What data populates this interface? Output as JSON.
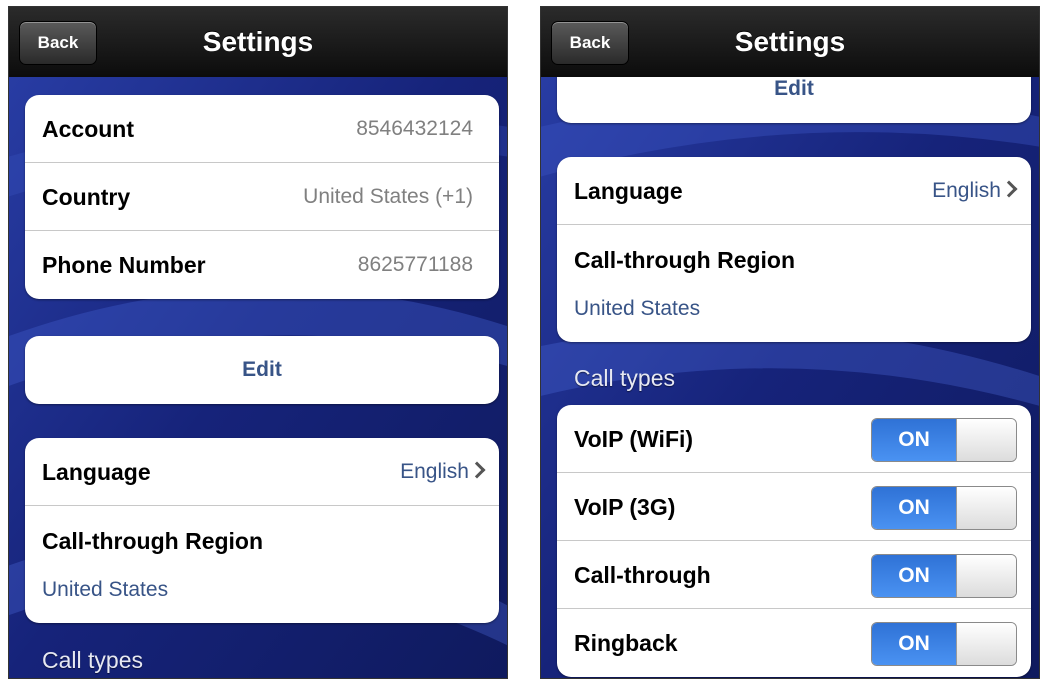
{
  "left_screen": {
    "nav": {
      "back_label": "Back",
      "title": "Settings"
    },
    "account_group": [
      {
        "label": "Account",
        "value": "8546432124"
      },
      {
        "label": "Country",
        "value": "United States (+1)"
      },
      {
        "label": "Phone Number",
        "value": "8625771188"
      }
    ],
    "edit_label": "Edit",
    "language": {
      "label": "Language",
      "value": "English"
    },
    "call_through": {
      "label": "Call-through Region",
      "value": "United States"
    },
    "call_types_header": "Call types"
  },
  "right_screen": {
    "nav": {
      "back_label": "Back",
      "title": "Settings"
    },
    "edit_label": "Edit",
    "language": {
      "label": "Language",
      "value": "English"
    },
    "call_through": {
      "label": "Call-through Region",
      "value": "United States"
    },
    "call_types_header": "Call types",
    "call_types": [
      {
        "label": "VoIP (WiFi)",
        "state": "ON"
      },
      {
        "label": "VoIP (3G)",
        "state": "ON"
      },
      {
        "label": "Call-through",
        "state": "ON"
      },
      {
        "label": "Ringback",
        "state": "ON"
      }
    ]
  },
  "colors": {
    "nav_bar": "#111111",
    "accent_blue": "#385487",
    "switch_on": "#3a82e6",
    "background": "#1a2a78"
  }
}
